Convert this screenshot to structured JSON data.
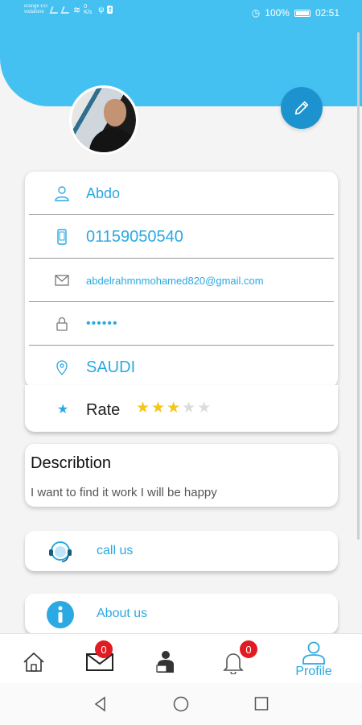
{
  "status_bar": {
    "carrier_1": "orange EG",
    "carrier_2": "vodafone",
    "net_speed": "0 K/s",
    "battery_percent": "100%",
    "time": "02:51"
  },
  "profile": {
    "name": "Abdo",
    "phone": "01159050540",
    "email": "abdelrahmnmohamed820@gmail.com",
    "password_masked": "••••••",
    "location": "SAUDI",
    "rate_label": "Rate",
    "rating": 3,
    "rating_max": 5
  },
  "description": {
    "title": "Describtion",
    "text": "I want to find it work I will be happy"
  },
  "links": {
    "call_us": "call us",
    "about_us": "About us"
  },
  "bottom_nav": {
    "messages_badge": "0",
    "notifications_badge": "0",
    "profile_label": "Profile"
  },
  "colors": {
    "accent": "#45c1f1",
    "text_accent": "#2aa9e2",
    "edit_button": "#1c93cf",
    "star_filled": "#f5c518",
    "star_empty": "#dcdcdc",
    "badge": "#e21b23"
  },
  "icons": {
    "name": "user-outline-icon",
    "phone": "mobile-phone-icon",
    "email": "envelope-icon",
    "password": "lock-icon",
    "location": "map-pin-icon",
    "rate": "star-icon",
    "call_us": "headset-support-icon",
    "about_us": "info-icon",
    "edit": "pencil-icon",
    "home": "home-icon",
    "messages": "mail-icon",
    "jobs": "worker-icon",
    "notifications": "bell-icon",
    "profile": "person-icon"
  }
}
